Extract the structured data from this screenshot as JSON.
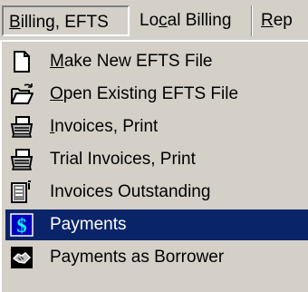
{
  "menubar": {
    "items": [
      {
        "label_pre": "",
        "label_mnemonic": "B",
        "label_post": "illing, EFTS"
      },
      {
        "label_pre": "Lo",
        "label_mnemonic": "c",
        "label_post": "al Billing"
      },
      {
        "label_pre": "",
        "label_mnemonic": "R",
        "label_post": "ep"
      }
    ]
  },
  "menu": {
    "items": [
      {
        "label_pre": "",
        "label_mnemonic": "M",
        "label_post": "ake New EFTS File",
        "icon": "new-file-icon"
      },
      {
        "label_pre": "",
        "label_mnemonic": "O",
        "label_post": "pen Existing EFTS File",
        "icon": "open-folder-icon"
      },
      {
        "label_pre": "",
        "label_mnemonic": "I",
        "label_post": "nvoices, Print",
        "icon": "printer-icon"
      },
      {
        "label_pre": "",
        "label_mnemonic": "",
        "label_post": "Trial Invoices, Print",
        "icon": "printer-icon"
      },
      {
        "label_pre": "",
        "label_mnemonic": "",
        "label_post": "Invoices Outstanding",
        "icon": "document-list-icon"
      },
      {
        "label_pre": "",
        "label_mnemonic": "",
        "label_post": "Payments",
        "icon": "dollar-icon",
        "selected": true
      },
      {
        "label_pre": "",
        "label_mnemonic": "",
        "label_post": "Payments as Borrower",
        "icon": "handshake-icon"
      }
    ]
  },
  "colors": {
    "menu_background": "#d4d0c8",
    "selection_background": "#0a246a",
    "selection_text": "#ffffff"
  }
}
